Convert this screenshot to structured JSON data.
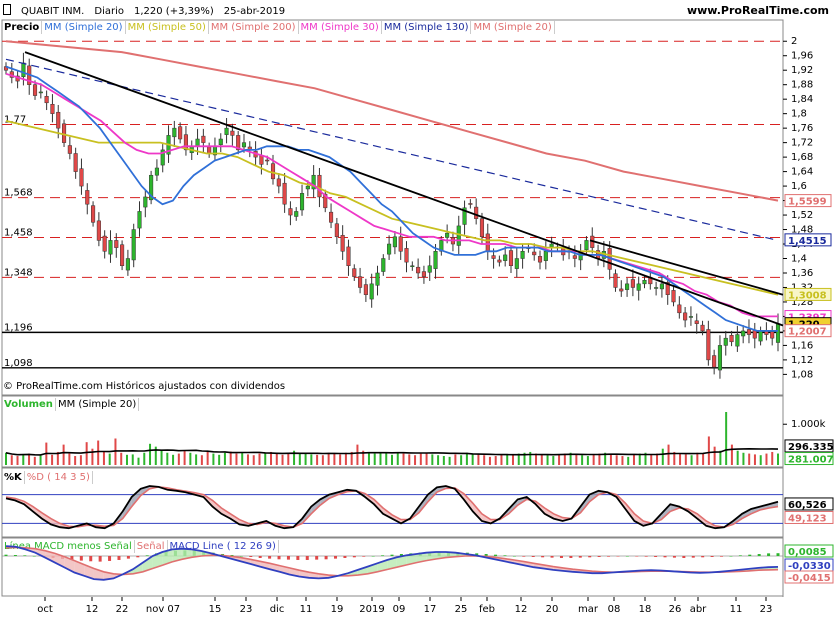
{
  "header": {
    "instrument": "QUABIT INM.",
    "timeframe": "Diario",
    "quote": "1,220 (+3,39%)",
    "date": "25-abr-2019",
    "site": "www.ProRealTime.com"
  },
  "copyright": "© ProRealTime.com  Históricos ajustados con dividendos",
  "colors": {
    "up": "#2db52d",
    "down": "#e04848",
    "mm20": "#3070d8",
    "mm50": "#c8c020",
    "mm200": "#e07070",
    "mm30": "#ee38c8",
    "mm130": "#1a2a9c",
    "trend": "#000000",
    "level": "#d82020",
    "macd": "#3040c0",
    "signal": "#e07070"
  },
  "chart_data": [
    {
      "type": "candlestick",
      "title": "Precio",
      "legend": [
        "Precio",
        "MM (Simple 20)",
        "MM (Simple 50)",
        "MM (Simple 200)",
        "MM (Simple 30)",
        "MM (Simple 130)",
        "MM (Simple 20)"
      ],
      "ylim": [
        1.07,
        2.02
      ],
      "y_ticks": [
        2,
        1.96,
        1.92,
        1.88,
        1.84,
        1.8,
        1.76,
        1.72,
        1.68,
        1.64,
        1.6,
        1.56,
        1.52,
        1.48,
        1.44,
        1.4,
        1.36,
        1.32,
        1.28,
        1.24,
        1.2,
        1.16,
        1.12,
        1.08
      ],
      "y_tick_labels": [
        "2",
        "1,96",
        "1,92",
        "1,88",
        "1,84",
        "1,8",
        "1,76",
        "1,72",
        "1,68",
        "1,64",
        "1,6",
        "1,56",
        "1,52",
        "1,48",
        "1,44",
        "1,4",
        "1,36",
        "1,32",
        "1,28",
        "1,24",
        "",
        "1,16",
        "1,12",
        "1,08"
      ],
      "x_ticks": [
        "oct",
        "12",
        "22",
        "nov 07",
        "15",
        "23",
        "dic",
        "11",
        "19",
        "2019",
        "09",
        "17",
        "25",
        "feb",
        "12",
        "20",
        "mar",
        "08",
        "18",
        "26",
        "abr",
        "11",
        "23"
      ],
      "horizontal_levels": [
        {
          "value": 1.77,
          "label": "1,77",
          "style": "dashed"
        },
        {
          "value": 1.568,
          "label": "1,568",
          "style": "dashed"
        },
        {
          "value": 1.458,
          "label": "1,458",
          "style": "dashed"
        },
        {
          "value": 1.348,
          "label": "1,348",
          "style": "dashed"
        },
        {
          "value": 1.196,
          "label": "1,196",
          "style": "solid"
        },
        {
          "value": 1.098,
          "label": "1,098",
          "style": "solid"
        },
        {
          "value": 2.0,
          "label": "",
          "style": "dashed"
        }
      ],
      "last_values": [
        {
          "name": "MM (Simple 200)",
          "value": "1,5599"
        },
        {
          "name": "MM (Simple 130)",
          "value": "1,4515"
        },
        {
          "name": "MM (Simple 50)",
          "value": "1,3008"
        },
        {
          "name": "MM (Simple 30)",
          "value": "1,2397"
        },
        {
          "name": "Precio",
          "value": "1,220"
        },
        {
          "name": "MM (Simple 20)",
          "value": "1,2007"
        }
      ],
      "closes": [
        1.92,
        1.9,
        1.89,
        1.94,
        1.88,
        1.85,
        1.86,
        1.83,
        1.8,
        1.76,
        1.72,
        1.69,
        1.64,
        1.6,
        1.55,
        1.5,
        1.45,
        1.42,
        1.45,
        1.43,
        1.38,
        1.4,
        1.48,
        1.53,
        1.57,
        1.63,
        1.65,
        1.7,
        1.74,
        1.76,
        1.73,
        1.7,
        1.71,
        1.73,
        1.72,
        1.69,
        1.71,
        1.73,
        1.76,
        1.74,
        1.7,
        1.72,
        1.7,
        1.68,
        1.66,
        1.67,
        1.62,
        1.6,
        1.55,
        1.52,
        1.53,
        1.58,
        1.6,
        1.63,
        1.57,
        1.54,
        1.5,
        1.46,
        1.42,
        1.38,
        1.35,
        1.32,
        1.3,
        1.33,
        1.36,
        1.4,
        1.44,
        1.46,
        1.42,
        1.39,
        1.38,
        1.36,
        1.35,
        1.38,
        1.42,
        1.45,
        1.47,
        1.44,
        1.49,
        1.54,
        1.55,
        1.51,
        1.46,
        1.42,
        1.4,
        1.39,
        1.41,
        1.38,
        1.4,
        1.42,
        1.43,
        1.41,
        1.39,
        1.42,
        1.44,
        1.43,
        1.41,
        1.42,
        1.4,
        1.42,
        1.45,
        1.43,
        1.4,
        1.42,
        1.37,
        1.32,
        1.31,
        1.33,
        1.32,
        1.33,
        1.34,
        1.33,
        1.32,
        1.33,
        1.3,
        1.28,
        1.25,
        1.23,
        1.24,
        1.22,
        1.2,
        1.12,
        1.1,
        1.16,
        1.18,
        1.17,
        1.19,
        1.2,
        1.19,
        1.18,
        1.2,
        1.19,
        1.18,
        1.22
      ],
      "mm20": [
        1.93,
        1.92,
        1.91,
        1.9,
        1.88,
        1.86,
        1.84,
        1.82,
        1.79,
        1.76,
        1.72,
        1.68,
        1.64,
        1.6,
        1.57,
        1.55,
        1.56,
        1.6,
        1.63,
        1.65,
        1.67,
        1.68,
        1.69,
        1.7,
        1.7,
        1.71,
        1.71,
        1.71,
        1.7,
        1.7,
        1.69,
        1.68,
        1.66,
        1.64,
        1.61,
        1.58,
        1.55,
        1.53,
        1.5,
        1.47,
        1.45,
        1.43,
        1.42,
        1.41,
        1.41,
        1.41,
        1.42,
        1.42,
        1.43,
        1.43,
        1.43,
        1.43,
        1.42,
        1.42,
        1.42,
        1.41,
        1.41,
        1.41,
        1.4,
        1.39,
        1.38,
        1.37,
        1.36,
        1.35,
        1.33,
        1.31,
        1.29,
        1.27,
        1.25,
        1.23,
        1.22,
        1.21,
        1.2,
        1.2,
        1.2
      ],
      "mm30": [
        1.91,
        1.9,
        1.89,
        1.88,
        1.86,
        1.84,
        1.82,
        1.8,
        1.78,
        1.75,
        1.72,
        1.7,
        1.69,
        1.69,
        1.7,
        1.71,
        1.71,
        1.71,
        1.71,
        1.71,
        1.7,
        1.69,
        1.68,
        1.66,
        1.64,
        1.62,
        1.6,
        1.57,
        1.55,
        1.53,
        1.51,
        1.49,
        1.48,
        1.47,
        1.46,
        1.46,
        1.46,
        1.45,
        1.45,
        1.45,
        1.44,
        1.44,
        1.44,
        1.43,
        1.43,
        1.43,
        1.42,
        1.42,
        1.42,
        1.41,
        1.41,
        1.4,
        1.39,
        1.38,
        1.37,
        1.36,
        1.34,
        1.33,
        1.31,
        1.3,
        1.28,
        1.27,
        1.25,
        1.24,
        1.24,
        1.24
      ],
      "mm50": [
        1.78,
        1.77,
        1.76,
        1.75,
        1.74,
        1.73,
        1.72,
        1.72,
        1.72,
        1.72,
        1.72,
        1.71,
        1.7,
        1.69,
        1.69,
        1.68,
        1.66,
        1.64,
        1.63,
        1.61,
        1.6,
        1.58,
        1.57,
        1.55,
        1.53,
        1.51,
        1.5,
        1.49,
        1.48,
        1.47,
        1.46,
        1.45,
        1.45,
        1.44,
        1.44,
        1.43,
        1.43,
        1.42,
        1.42,
        1.41,
        1.4,
        1.39,
        1.38,
        1.37,
        1.36,
        1.35,
        1.34,
        1.33,
        1.32,
        1.31,
        1.3
      ],
      "mm130": [
        1.95,
        1.93,
        1.91,
        1.89,
        1.87,
        1.85,
        1.83,
        1.81,
        1.79,
        1.77,
        1.75,
        1.73,
        1.71,
        1.69,
        1.67,
        1.65,
        1.63,
        1.61,
        1.59,
        1.57,
        1.55,
        1.53,
        1.51,
        1.49,
        1.47,
        1.45
      ],
      "mm200": [
        2.0,
        1.99,
        1.98,
        1.97,
        1.95,
        1.93,
        1.91,
        1.89,
        1.87,
        1.84,
        1.81,
        1.78,
        1.75,
        1.72,
        1.69,
        1.67,
        1.64,
        1.62,
        1.6,
        1.58,
        1.56
      ]
    },
    {
      "type": "bar",
      "title": "Volumen",
      "legend": [
        "Volumen",
        "MM (Simple 20)"
      ],
      "y_tick_labels": [
        "1.000k"
      ],
      "last_values": [
        {
          "name": "MM (Simple 20)",
          "value": "296.335"
        },
        {
          "name": "Volumen",
          "value": "281.007"
        }
      ],
      "values_k": [
        300,
        240,
        220,
        260,
        280,
        200,
        230,
        550,
        250,
        320,
        500,
        280,
        220,
        240,
        560,
        400,
        600,
        320,
        280,
        650,
        300,
        250,
        260,
        180,
        300,
        520,
        450,
        380,
        300,
        250,
        280,
        350,
        300,
        260,
        240,
        320,
        280,
        250,
        300,
        330,
        280,
        300,
        260,
        240,
        280,
        300,
        320,
        280,
        250,
        300,
        350,
        300,
        280,
        260,
        250,
        240,
        300,
        280,
        260,
        300,
        320,
        500,
        350,
        300,
        280,
        320,
        300,
        250,
        300,
        280,
        260,
        240,
        280,
        300,
        260,
        240,
        220,
        200,
        260,
        240,
        300,
        280,
        260,
        240,
        200,
        220,
        250,
        260,
        240,
        280,
        300,
        320,
        280,
        260,
        240,
        220,
        260,
        280,
        300,
        260,
        240,
        220,
        260,
        280,
        300,
        250,
        240,
        220,
        200,
        260,
        280,
        300,
        260,
        280,
        400,
        500,
        320,
        280,
        260,
        240,
        300,
        280,
        700,
        450,
        350,
        1300,
        500,
        350,
        300,
        280,
        260,
        240,
        280,
        320,
        281
      ]
    },
    {
      "type": "line",
      "title": "%K",
      "legend": [
        "%K",
        "%D ( 14 3 5)"
      ],
      "ylim": [
        0,
        100
      ],
      "last_values": [
        {
          "name": "%K",
          "value": "60,526"
        },
        {
          "name": "%D ( 14 3 5)",
          "value": "49,123"
        }
      ],
      "k": [
        72,
        68,
        60,
        45,
        30,
        18,
        12,
        10,
        15,
        20,
        12,
        10,
        20,
        45,
        75,
        92,
        98,
        96,
        90,
        88,
        85,
        80,
        75,
        55,
        40,
        30,
        18,
        15,
        20,
        25,
        15,
        10,
        12,
        30,
        55,
        70,
        80,
        85,
        90,
        88,
        75,
        60,
        40,
        30,
        20,
        30,
        55,
        80,
        95,
        98,
        92,
        70,
        45,
        25,
        20,
        30,
        50,
        70,
        75,
        60,
        40,
        30,
        25,
        30,
        55,
        80,
        88,
        85,
        75,
        50,
        25,
        15,
        20,
        40,
        60,
        55,
        45,
        30,
        15,
        10,
        12,
        25,
        40,
        50,
        55,
        60,
        65
      ],
      "d": [
        75,
        72,
        66,
        55,
        42,
        30,
        20,
        14,
        13,
        16,
        16,
        14,
        16,
        30,
        55,
        78,
        92,
        96,
        94,
        90,
        87,
        84,
        80,
        68,
        52,
        40,
        28,
        20,
        18,
        22,
        20,
        15,
        12,
        20,
        40,
        58,
        72,
        80,
        86,
        88,
        82,
        70,
        52,
        38,
        28,
        28,
        42,
        65,
        85,
        93,
        94,
        82,
        62,
        40,
        28,
        28,
        40,
        58,
        70,
        66,
        52,
        40,
        32,
        30,
        42,
        65,
        80,
        85,
        80,
        62,
        40,
        25,
        20,
        28,
        45,
        52,
        50,
        40,
        25,
        15,
        12,
        18,
        30,
        40,
        48,
        52,
        55
      ]
    },
    {
      "type": "bar",
      "title": "Línea MACD menos Señal",
      "legend": [
        "Línea MACD menos Señal",
        "Señal",
        "MACD Line ( 12 26 9)"
      ],
      "last_values": [
        {
          "name": "Línea MACD menos Señal",
          "value": "0,0085"
        },
        {
          "name": "MACD Line ( 12 26 9)",
          "value": "-0,0330"
        },
        {
          "name": "Señal",
          "value": "-0,0415"
        }
      ],
      "hist": [
        0.004,
        0.003,
        0.002,
        0,
        -0.003,
        -0.006,
        -0.009,
        -0.012,
        -0.014,
        -0.016,
        -0.017,
        -0.015,
        -0.012,
        -0.008,
        -0.004,
        0.002,
        0.008,
        0.013,
        0.016,
        0.017,
        0.016,
        0.013,
        0.01,
        0.006,
        0.003,
        0,
        -0.003,
        -0.006,
        -0.008,
        -0.01,
        -0.011,
        -0.012,
        -0.012,
        -0.011,
        -0.01,
        -0.008,
        -0.006,
        -0.004,
        -0.002,
        0,
        0.002,
        0.004,
        0.006,
        0.008,
        0.01,
        0.011,
        0.012,
        0.012,
        0.011,
        0.01,
        0.008,
        0.006,
        0.004,
        0.002,
        0,
        -0.002,
        -0.003,
        -0.004,
        -0.005,
        -0.006,
        -0.006,
        -0.005,
        -0.004,
        -0.003,
        -0.002,
        -0.001,
        0,
        -0.001,
        -0.002,
        -0.003,
        -0.004,
        -0.005,
        -0.006,
        -0.005,
        -0.004,
        -0.003,
        -0.002,
        0,
        0.002,
        0.004,
        0.006,
        0.008,
        0.0085
      ],
      "macd": [
        0.03,
        0.028,
        0.02,
        0.01,
        -0.005,
        -0.02,
        -0.035,
        -0.05,
        -0.06,
        -0.07,
        -0.072,
        -0.068,
        -0.055,
        -0.04,
        -0.02,
        0,
        0.012,
        0.02,
        0.022,
        0.02,
        0.015,
        0.008,
        0,
        -0.008,
        -0.016,
        -0.024,
        -0.032,
        -0.04,
        -0.048,
        -0.056,
        -0.062,
        -0.066,
        -0.068,
        -0.066,
        -0.06,
        -0.052,
        -0.042,
        -0.032,
        -0.022,
        -0.012,
        -0.004,
        0.002,
        0.006,
        0.01,
        0.012,
        0.012,
        0.01,
        0.006,
        0.002,
        -0.004,
        -0.01,
        -0.016,
        -0.022,
        -0.028,
        -0.034,
        -0.038,
        -0.042,
        -0.045,
        -0.048,
        -0.05,
        -0.052,
        -0.052,
        -0.05,
        -0.048,
        -0.046,
        -0.044,
        -0.043,
        -0.044,
        -0.046,
        -0.048,
        -0.05,
        -0.051,
        -0.05,
        -0.048,
        -0.045,
        -0.042,
        -0.039,
        -0.036,
        -0.034,
        -0.033
      ],
      "signal": [
        0.025,
        0.026,
        0.025,
        0.022,
        0.016,
        0.008,
        -0.002,
        -0.014,
        -0.026,
        -0.038,
        -0.048,
        -0.054,
        -0.056,
        -0.054,
        -0.048,
        -0.038,
        -0.028,
        -0.018,
        -0.01,
        -0.004,
        0,
        0.002,
        0.002,
        -0.001,
        -0.005,
        -0.01,
        -0.016,
        -0.022,
        -0.029,
        -0.036,
        -0.043,
        -0.049,
        -0.054,
        -0.058,
        -0.06,
        -0.06,
        -0.058,
        -0.054,
        -0.048,
        -0.041,
        -0.034,
        -0.027,
        -0.02,
        -0.014,
        -0.009,
        -0.005,
        -0.002,
        0,
        0,
        -0.001,
        -0.004,
        -0.008,
        -0.012,
        -0.017,
        -0.022,
        -0.027,
        -0.032,
        -0.036,
        -0.04,
        -0.043,
        -0.046,
        -0.048,
        -0.049,
        -0.049,
        -0.048,
        -0.047,
        -0.046,
        -0.046,
        -0.046,
        -0.047,
        -0.048,
        -0.049,
        -0.049,
        -0.049,
        -0.048,
        -0.047,
        -0.045,
        -0.043,
        -0.042,
        -0.0415
      ]
    }
  ]
}
